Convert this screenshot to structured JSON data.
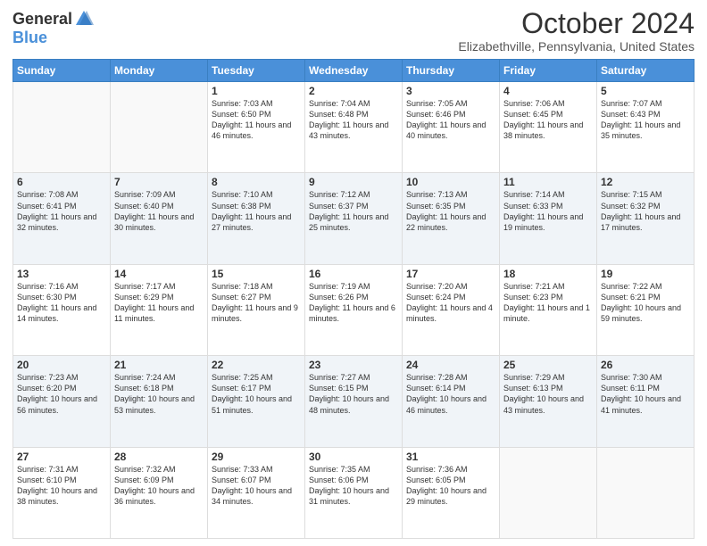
{
  "header": {
    "logo_general": "General",
    "logo_blue": "Blue",
    "month": "October 2024",
    "location": "Elizabethville, Pennsylvania, United States"
  },
  "days_of_week": [
    "Sunday",
    "Monday",
    "Tuesday",
    "Wednesday",
    "Thursday",
    "Friday",
    "Saturday"
  ],
  "weeks": [
    [
      {
        "day": "",
        "info": ""
      },
      {
        "day": "",
        "info": ""
      },
      {
        "day": "1",
        "info": "Sunrise: 7:03 AM\nSunset: 6:50 PM\nDaylight: 11 hours and 46 minutes."
      },
      {
        "day": "2",
        "info": "Sunrise: 7:04 AM\nSunset: 6:48 PM\nDaylight: 11 hours and 43 minutes."
      },
      {
        "day": "3",
        "info": "Sunrise: 7:05 AM\nSunset: 6:46 PM\nDaylight: 11 hours and 40 minutes."
      },
      {
        "day": "4",
        "info": "Sunrise: 7:06 AM\nSunset: 6:45 PM\nDaylight: 11 hours and 38 minutes."
      },
      {
        "day": "5",
        "info": "Sunrise: 7:07 AM\nSunset: 6:43 PM\nDaylight: 11 hours and 35 minutes."
      }
    ],
    [
      {
        "day": "6",
        "info": "Sunrise: 7:08 AM\nSunset: 6:41 PM\nDaylight: 11 hours and 32 minutes."
      },
      {
        "day": "7",
        "info": "Sunrise: 7:09 AM\nSunset: 6:40 PM\nDaylight: 11 hours and 30 minutes."
      },
      {
        "day": "8",
        "info": "Sunrise: 7:10 AM\nSunset: 6:38 PM\nDaylight: 11 hours and 27 minutes."
      },
      {
        "day": "9",
        "info": "Sunrise: 7:12 AM\nSunset: 6:37 PM\nDaylight: 11 hours and 25 minutes."
      },
      {
        "day": "10",
        "info": "Sunrise: 7:13 AM\nSunset: 6:35 PM\nDaylight: 11 hours and 22 minutes."
      },
      {
        "day": "11",
        "info": "Sunrise: 7:14 AM\nSunset: 6:33 PM\nDaylight: 11 hours and 19 minutes."
      },
      {
        "day": "12",
        "info": "Sunrise: 7:15 AM\nSunset: 6:32 PM\nDaylight: 11 hours and 17 minutes."
      }
    ],
    [
      {
        "day": "13",
        "info": "Sunrise: 7:16 AM\nSunset: 6:30 PM\nDaylight: 11 hours and 14 minutes."
      },
      {
        "day": "14",
        "info": "Sunrise: 7:17 AM\nSunset: 6:29 PM\nDaylight: 11 hours and 11 minutes."
      },
      {
        "day": "15",
        "info": "Sunrise: 7:18 AM\nSunset: 6:27 PM\nDaylight: 11 hours and 9 minutes."
      },
      {
        "day": "16",
        "info": "Sunrise: 7:19 AM\nSunset: 6:26 PM\nDaylight: 11 hours and 6 minutes."
      },
      {
        "day": "17",
        "info": "Sunrise: 7:20 AM\nSunset: 6:24 PM\nDaylight: 11 hours and 4 minutes."
      },
      {
        "day": "18",
        "info": "Sunrise: 7:21 AM\nSunset: 6:23 PM\nDaylight: 11 hours and 1 minute."
      },
      {
        "day": "19",
        "info": "Sunrise: 7:22 AM\nSunset: 6:21 PM\nDaylight: 10 hours and 59 minutes."
      }
    ],
    [
      {
        "day": "20",
        "info": "Sunrise: 7:23 AM\nSunset: 6:20 PM\nDaylight: 10 hours and 56 minutes."
      },
      {
        "day": "21",
        "info": "Sunrise: 7:24 AM\nSunset: 6:18 PM\nDaylight: 10 hours and 53 minutes."
      },
      {
        "day": "22",
        "info": "Sunrise: 7:25 AM\nSunset: 6:17 PM\nDaylight: 10 hours and 51 minutes."
      },
      {
        "day": "23",
        "info": "Sunrise: 7:27 AM\nSunset: 6:15 PM\nDaylight: 10 hours and 48 minutes."
      },
      {
        "day": "24",
        "info": "Sunrise: 7:28 AM\nSunset: 6:14 PM\nDaylight: 10 hours and 46 minutes."
      },
      {
        "day": "25",
        "info": "Sunrise: 7:29 AM\nSunset: 6:13 PM\nDaylight: 10 hours and 43 minutes."
      },
      {
        "day": "26",
        "info": "Sunrise: 7:30 AM\nSunset: 6:11 PM\nDaylight: 10 hours and 41 minutes."
      }
    ],
    [
      {
        "day": "27",
        "info": "Sunrise: 7:31 AM\nSunset: 6:10 PM\nDaylight: 10 hours and 38 minutes."
      },
      {
        "day": "28",
        "info": "Sunrise: 7:32 AM\nSunset: 6:09 PM\nDaylight: 10 hours and 36 minutes."
      },
      {
        "day": "29",
        "info": "Sunrise: 7:33 AM\nSunset: 6:07 PM\nDaylight: 10 hours and 34 minutes."
      },
      {
        "day": "30",
        "info": "Sunrise: 7:35 AM\nSunset: 6:06 PM\nDaylight: 10 hours and 31 minutes."
      },
      {
        "day": "31",
        "info": "Sunrise: 7:36 AM\nSunset: 6:05 PM\nDaylight: 10 hours and 29 minutes."
      },
      {
        "day": "",
        "info": ""
      },
      {
        "day": "",
        "info": ""
      }
    ]
  ]
}
